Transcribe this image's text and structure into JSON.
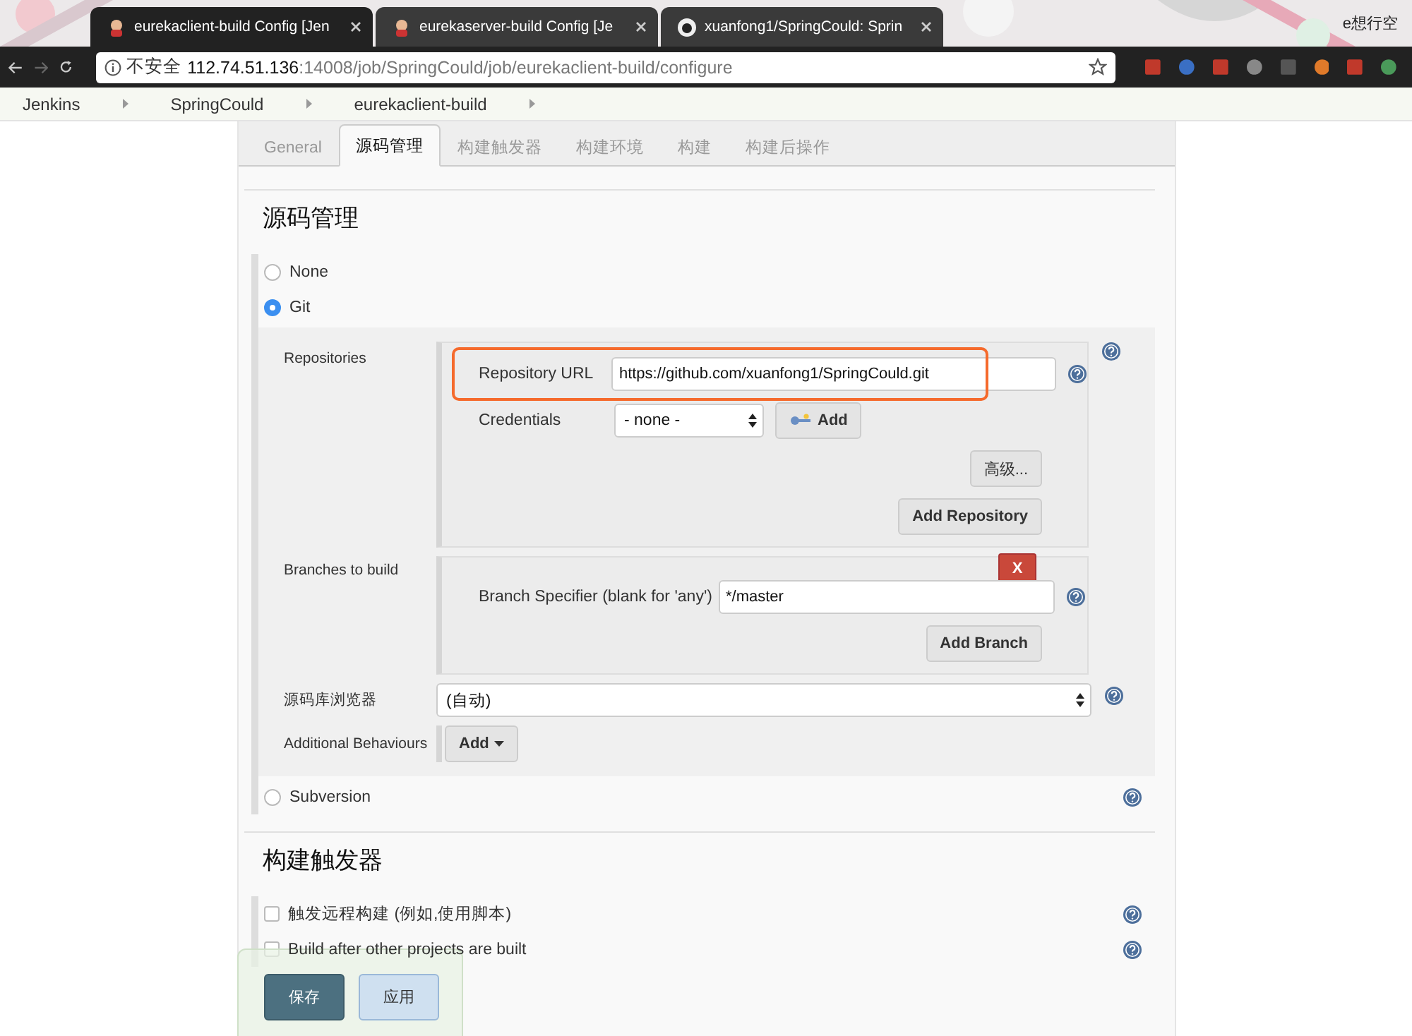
{
  "browser": {
    "tabs": [
      {
        "title": "eurekaclient-build Config [Jen",
        "selected": true,
        "kind": "jenkins"
      },
      {
        "title": "eurekaserver-build Config [Je",
        "selected": false,
        "kind": "jenkins"
      },
      {
        "title": "xuanfong1/SpringCould: Sprin",
        "selected": false,
        "kind": "github"
      }
    ],
    "profile": "e想行空",
    "address": {
      "security": "不安全",
      "host": "112.74.51.136",
      "path": ":14008/job/SpringCould/job/eurekaclient-build/configure"
    }
  },
  "breadcrumbs": [
    "Jenkins",
    "SpringCould",
    "eurekaclient-build"
  ],
  "config_tabs": [
    {
      "label": "General",
      "selected": false
    },
    {
      "label": "源码管理",
      "selected": true
    },
    {
      "label": "构建触发器",
      "selected": false
    },
    {
      "label": "构建环境",
      "selected": false
    },
    {
      "label": "构建",
      "selected": false
    },
    {
      "label": "构建后操作",
      "selected": false
    }
  ],
  "scm": {
    "title": "源码管理",
    "options": [
      {
        "label": "None",
        "selected": false,
        "kind": "plain"
      },
      {
        "label": "Git",
        "selected": true,
        "kind": "git"
      },
      {
        "label": "Subversion",
        "selected": false,
        "kind": "plain"
      }
    ],
    "git": {
      "repositories_label": "Repositories",
      "repository_url_label": "Repository URL",
      "repository_url": "https://github.com/xuanfong1/SpringCould.git",
      "repository_url_highlighted": true,
      "credentials_label": "Credentials",
      "credentials_value": "- none -",
      "add_credentials": "Add",
      "advanced": "高级...",
      "add_repository": "Add Repository",
      "branches_label": "Branches to build",
      "delete_branch": "X",
      "branch_specifier_label": "Branch Specifier (blank for 'any')",
      "branch_specifier": "*/master",
      "add_branch": "Add Branch",
      "browser_label": "源码库浏览器",
      "browser_value": "(自动)",
      "behaviours_label": "Additional Behaviours",
      "behaviours_add": "Add"
    }
  },
  "triggers": {
    "title": "构建触发器",
    "items": [
      {
        "label": "触发远程构建 (例如,使用脚本)",
        "checked": false
      },
      {
        "label": "Build after other projects are built",
        "checked": false
      }
    ]
  },
  "save_bar": {
    "save": "保存",
    "apply": "应用"
  }
}
